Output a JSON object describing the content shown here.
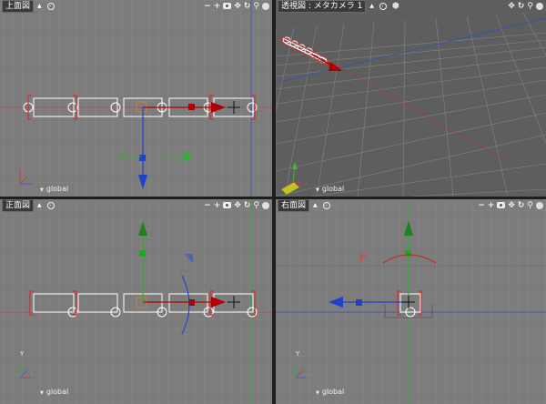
{
  "viewports": {
    "top": {
      "title": "上面図"
    },
    "perspective": {
      "title": "透視図 : メタカメラ 1"
    },
    "front": {
      "title": "正面図"
    },
    "right": {
      "title": "右面図"
    }
  },
  "coordinate_label": "global",
  "axis_label_y": "Y",
  "toolbar_symbols": {
    "zoom_out": "−",
    "zoom_in": "+",
    "pan": "✥",
    "rotate": "↻",
    "zoom": "⚲"
  },
  "colors": {
    "x_axis": "#b83030",
    "y_axis": "#30c030",
    "z_axis": "#2040d0",
    "handle_red": "#b00000",
    "selection": "#d03030"
  }
}
